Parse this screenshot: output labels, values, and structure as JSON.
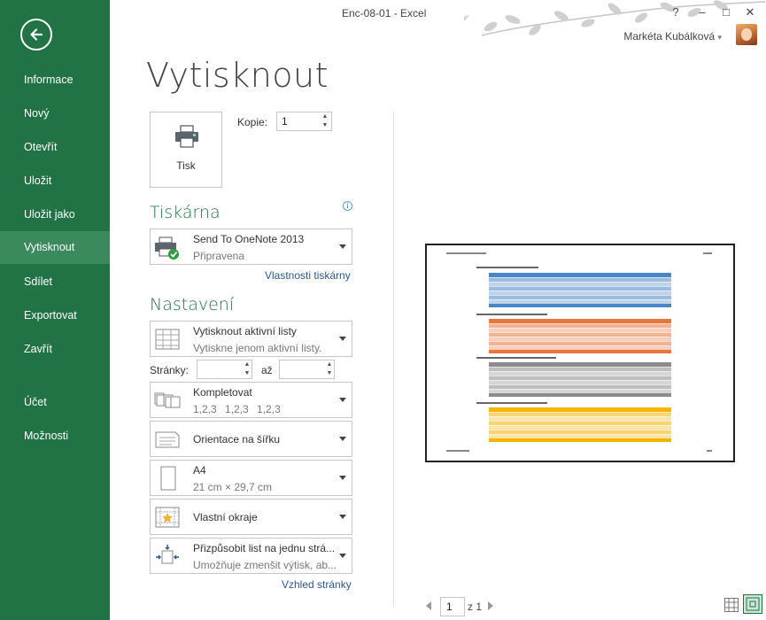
{
  "window": {
    "title": "Enc-08-01 - Excel",
    "help": "?",
    "minimize": "–",
    "maximize": "□",
    "close": "✕"
  },
  "user": {
    "name": "Markéta Kubálková",
    "caret": "▾"
  },
  "sidebar": {
    "items": [
      {
        "label": "Informace"
      },
      {
        "label": "Nový"
      },
      {
        "label": "Otevřít"
      },
      {
        "label": "Uložit"
      },
      {
        "label": "Uložit jako"
      },
      {
        "label": "Vytisknout"
      },
      {
        "label": "Sdílet"
      },
      {
        "label": "Exportovat"
      },
      {
        "label": "Zavřít"
      },
      {
        "label": "Účet"
      },
      {
        "label": "Možnosti"
      }
    ],
    "active_index": 5
  },
  "main": {
    "title": "Vytisknout",
    "print_button_label": "Tisk",
    "copies_label": "Kopie:",
    "copies_value": "1",
    "printer_heading": "Tiskárna",
    "printer": {
      "name": "Send To OneNote 2013",
      "status": "Připravena"
    },
    "printer_properties_link": "Vlastnosti tiskárny",
    "settings_heading": "Nastavení",
    "settings": [
      {
        "line1": "Vytisknout aktivní listy",
        "line2": "Vytiskne jenom aktivní listy."
      },
      {
        "line1": "Kompletovat",
        "line2": "1,2,3    1,2,3    1,2,3"
      },
      {
        "line1": "Orientace na šířku",
        "line2": ""
      },
      {
        "line1": "A4",
        "line2": "21 cm × 29,7 cm"
      },
      {
        "line1": "Vlastní okraje",
        "line2": ""
      },
      {
        "line1": "Přizpůsobit list na jednu strá...",
        "line2": "Umožňuje zmenšit výtisk, ab..."
      }
    ],
    "pages_label": "Stránky:",
    "pages_to_label": "až",
    "page_setup_link": "Vzhled stránky"
  },
  "preview": {
    "current_page": "1",
    "page_of": "z 1",
    "table_colors": [
      "#4a86c8",
      "#e8763a",
      "#8c8c8c",
      "#f4b400"
    ]
  }
}
